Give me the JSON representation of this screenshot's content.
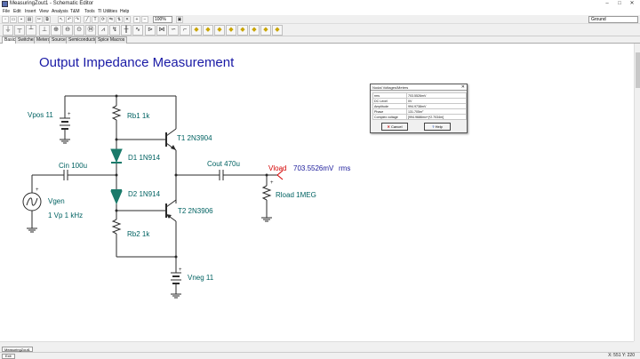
{
  "window": {
    "title": "MeasuringZout1 - Schematic Editor"
  },
  "menu": [
    "File",
    "Edit",
    "Insert",
    "View",
    "Analysis",
    "T&M",
    "Tools",
    "TI Utilities",
    "Help"
  ],
  "toolbar": {
    "zoom_value": "100%",
    "layer_value": "Ground"
  },
  "component_tabs": [
    "Basic",
    "Switches",
    "Meters",
    "Sources",
    "Semiconductors",
    "Spice Macros"
  ],
  "schematic": {
    "title": "Output Impedance Measurement",
    "labels": {
      "vpos": "Vpos 11",
      "rb1": "Rb1 1k",
      "t1": "T1 2N3904",
      "d1": "D1 1N914",
      "cin": "Cin 100u",
      "vgen": "Vgen",
      "vgen_value": "1 Vp 1 kHz",
      "d2": "D2 1N914",
      "t2": "T2 2N3906",
      "rb2": "Rb2 1k",
      "vneg": "Vneg 11",
      "cout": "Cout 470u",
      "vload": "Vload",
      "vload_value": "703.5526mV",
      "vload_unit": "rms",
      "rload": "Rload 1MEG"
    }
  },
  "dialog": {
    "title": "Nodal Voltages/Meters",
    "rows": [
      {
        "key": "rms",
        "value": "703.5526mV"
      },
      {
        "key": "DC Level",
        "value": "0V"
      },
      {
        "key": "Amplitude",
        "value": "994.9738mV"
      },
      {
        "key": "Phase",
        "value": "131.705m°"
      },
      {
        "key": "Complex voltage",
        "value": "[994.9686mv+j*2.7034m]"
      }
    ],
    "cancel_label": "Cancel",
    "help_label": "Help"
  },
  "bottom_tab": "MeasuringZout1",
  "status": {
    "exit_label": "Exit",
    "coords": "X: 551  Y: 220"
  }
}
